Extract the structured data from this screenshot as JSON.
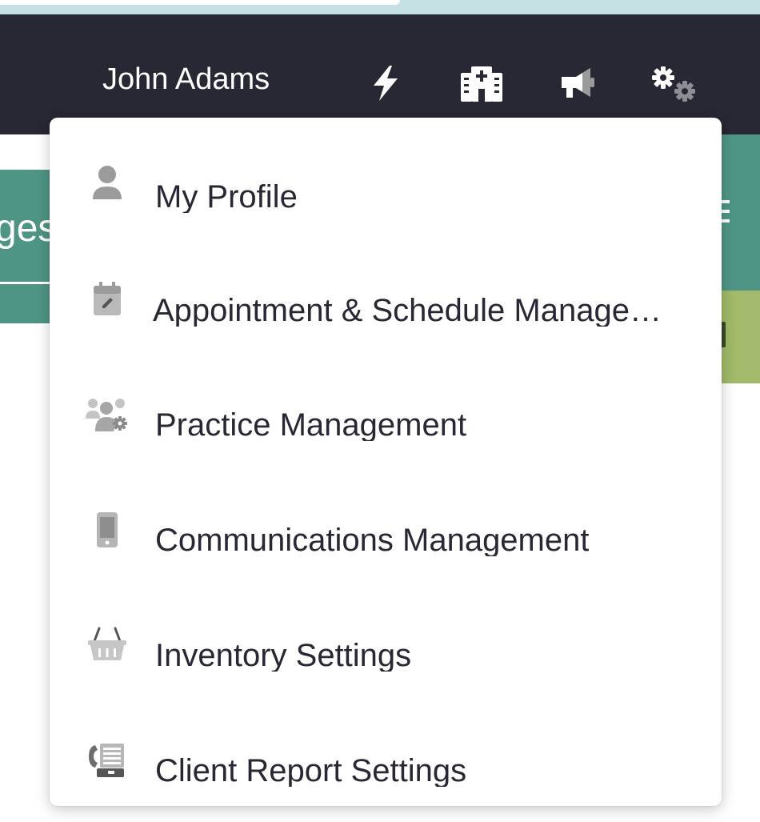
{
  "header": {
    "user_name": "John Adams",
    "icons": [
      "bolt-icon",
      "hospital-icon",
      "megaphone-icon",
      "cogs-icon"
    ]
  },
  "background": {
    "title_fragment": "ges"
  },
  "user_menu": {
    "items": [
      {
        "label": "My Profile",
        "icon": "user-icon"
      },
      {
        "label": "Appointment & Schedule Management",
        "icon": "calendar-edit-icon"
      },
      {
        "label": "Practice Management",
        "icon": "users-cog-icon"
      },
      {
        "label": "Communications Management",
        "icon": "mobile-phone-icon"
      },
      {
        "label": "Inventory Settings",
        "icon": "shopping-basket-icon"
      },
      {
        "label": "Client Report Settings",
        "icon": "phone-fax-icon"
      }
    ]
  },
  "colors": {
    "navbar": "#272833",
    "teal": "#4f9585",
    "olive": "#a1ba6b",
    "icon_gray": "#999999",
    "text": "#272833"
  }
}
